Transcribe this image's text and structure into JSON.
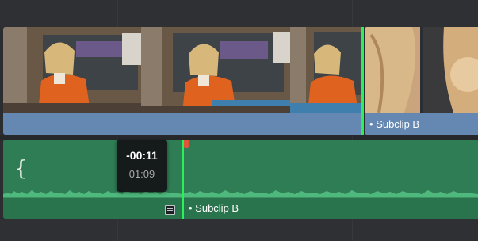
{
  "video_track": {
    "clip_b_label": "• Subclip B"
  },
  "audio_track": {
    "clip_b_label": "• Subclip B",
    "brace_glyph": "{"
  },
  "timecode_tooltip": {
    "offset": "-00:11",
    "duration": "01:09"
  },
  "colors": {
    "video_clip": "#5b7aa3",
    "audio_clip": "#2f7d55",
    "edit_point": "#2cf05a",
    "playhead": "#e0543a"
  },
  "icons": [
    "clip-menu-icon",
    "playhead-marker-icon"
  ]
}
